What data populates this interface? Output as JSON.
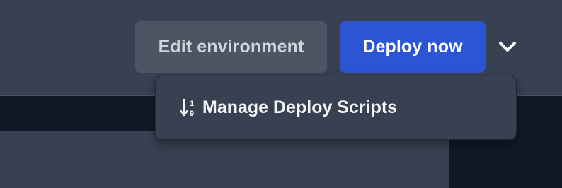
{
  "header": {
    "edit_environment_label": "Edit environment",
    "deploy_now_label": "Deploy now",
    "more_options_icon": "chevron-down-icon"
  },
  "dropdown": {
    "items": [
      {
        "label": "Manage Deploy Scripts",
        "icon": "sort-numeric-down-icon"
      }
    ]
  },
  "colors": {
    "header_bg": "#374151",
    "page_bg": "#111827",
    "edit_button_bg": "#4b5563",
    "edit_button_text": "#d1d5db",
    "deploy_button_bg": "#2c55d4",
    "deploy_button_text": "#ffffff",
    "menu_bg": "#374151",
    "menu_text": "#f3f4f6"
  }
}
